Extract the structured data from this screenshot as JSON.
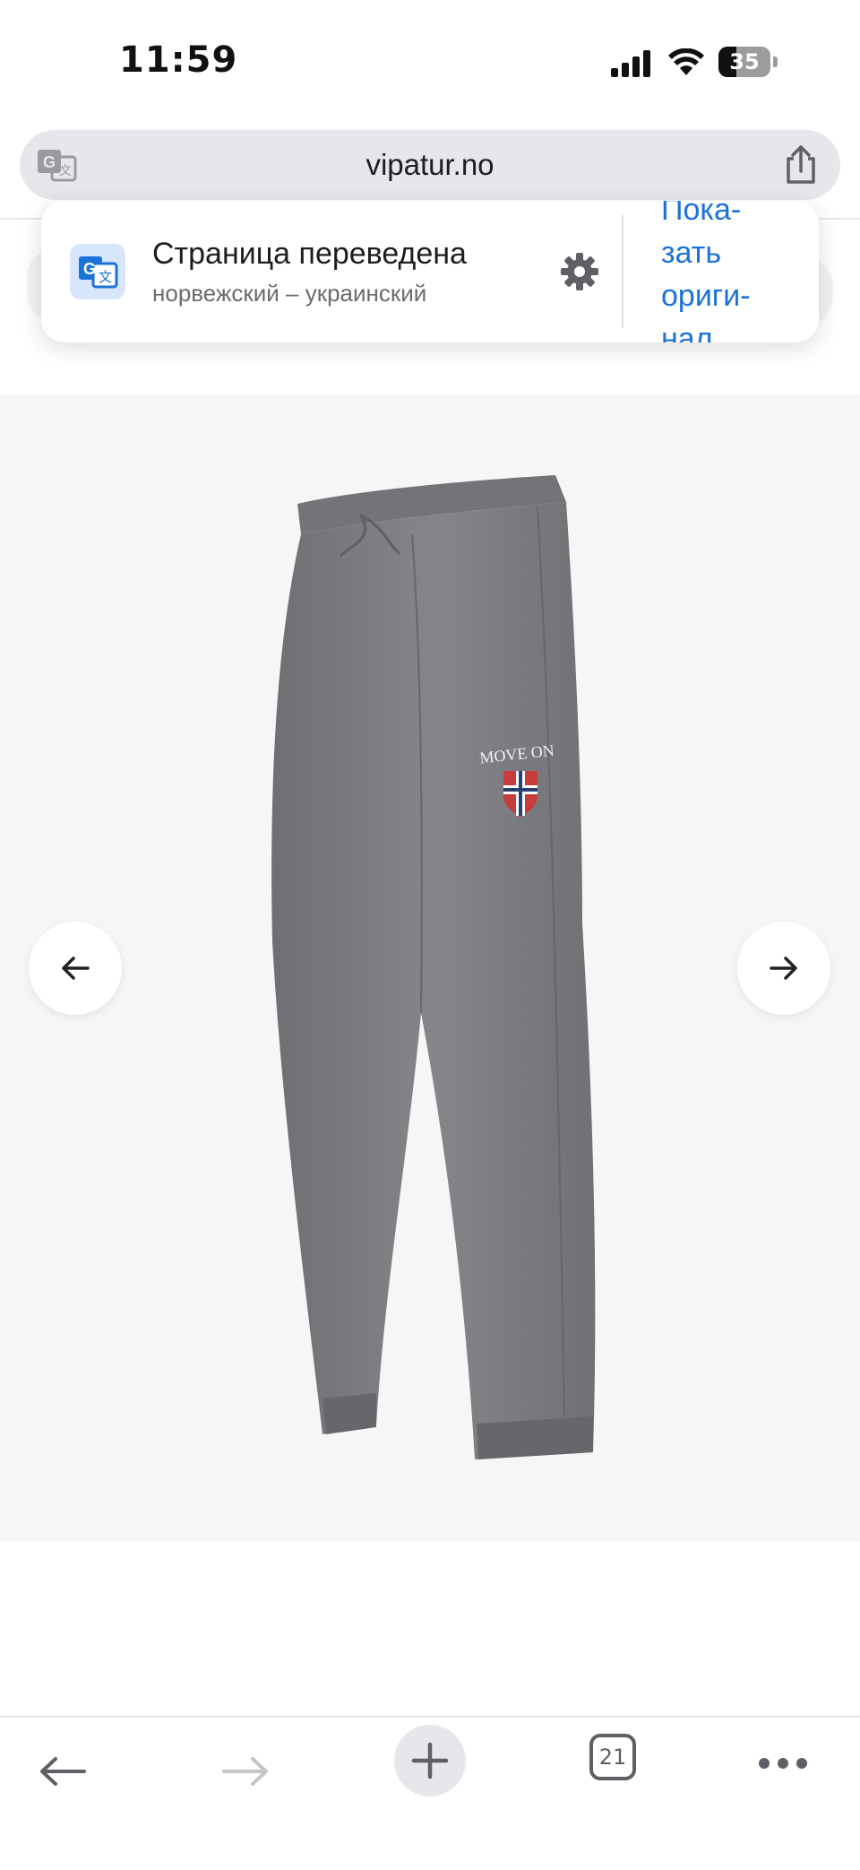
{
  "status_bar": {
    "time": "11:59",
    "battery": "35",
    "battery_level_percent": 35
  },
  "address_bar": {
    "url": "vipatur.no"
  },
  "translation_popup": {
    "title": "Страница переведена",
    "subtitle": "норвежский – украинский",
    "show_original_label": "Пока-\nзать\nориги-\nнал"
  },
  "product": {
    "image_text": "MOVE ON"
  },
  "toolbar": {
    "tab_count": "21"
  },
  "colors": {
    "accent": "#1b72d8",
    "address_bar_bg": "#e6e7ea",
    "product_bg": "#f6f6f6"
  },
  "icons": {
    "translate": "google-translate-icon",
    "share": "share-icon",
    "settings": "gear-icon",
    "prev": "arrow-left-icon",
    "next": "arrow-right-icon",
    "back": "back-arrow-icon",
    "forward": "forward-arrow-icon",
    "new_tab": "plus-icon",
    "tabs": "tabs-icon",
    "more": "more-icon"
  }
}
